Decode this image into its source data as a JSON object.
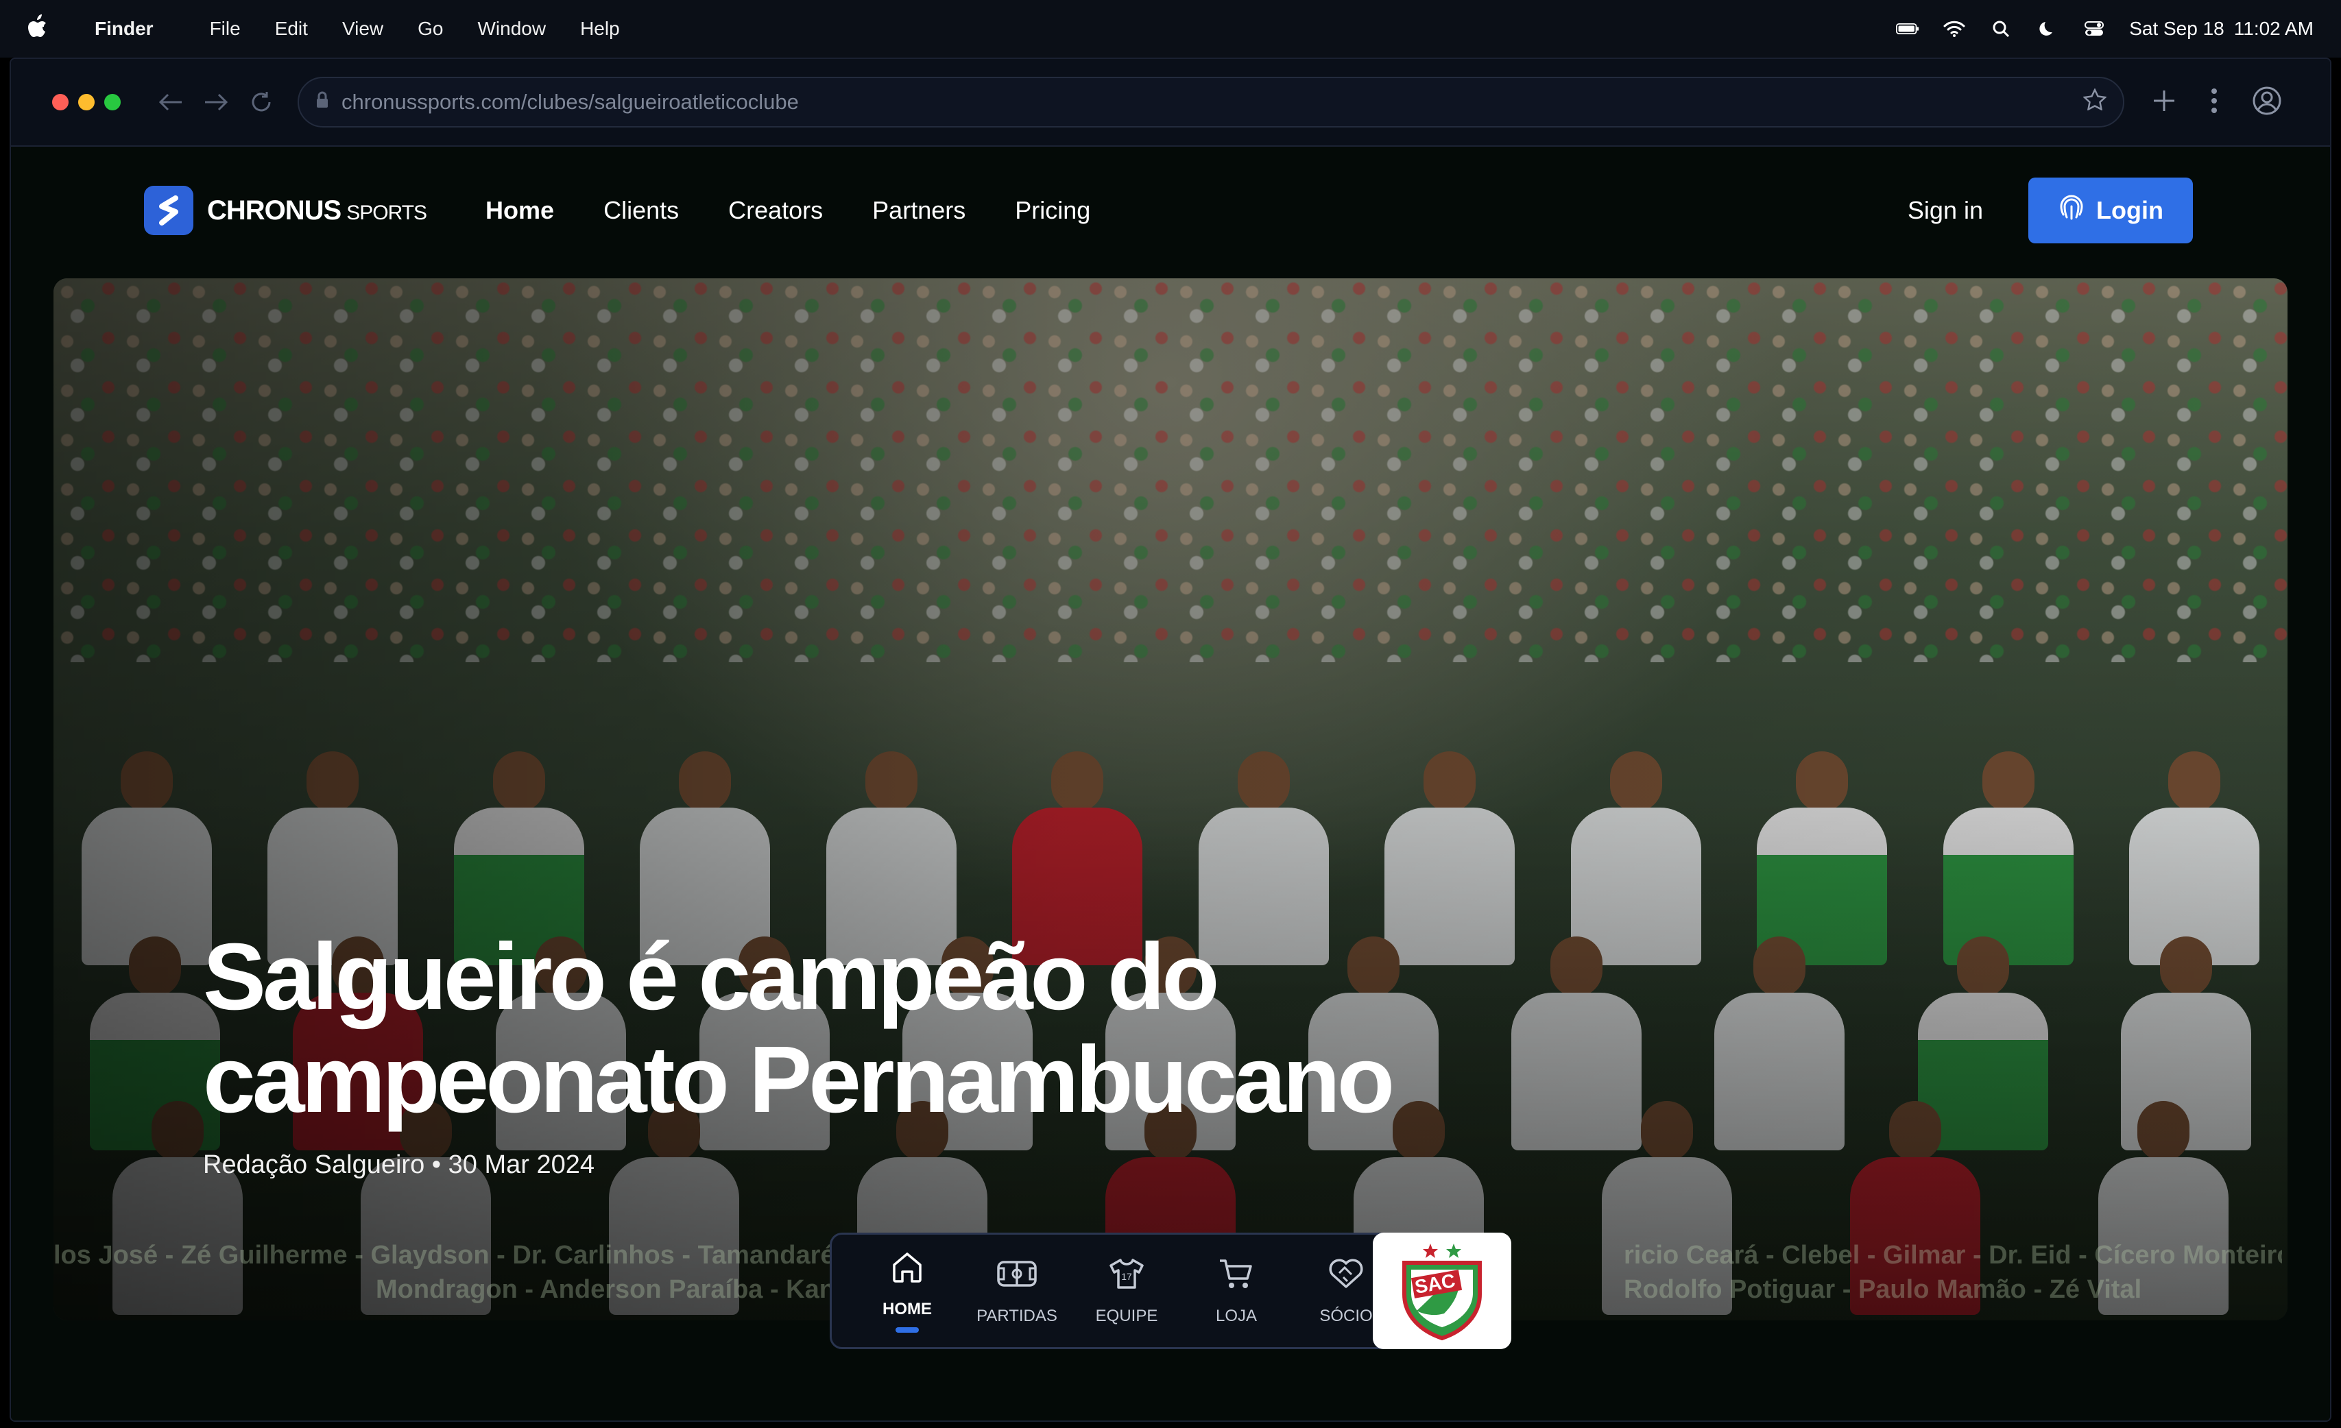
{
  "menubar": {
    "app": "Finder",
    "items": [
      "File",
      "Edit",
      "View",
      "Go",
      "Window",
      "Help"
    ],
    "date": "Sat Sep 18",
    "time": "11:02 AM"
  },
  "browser": {
    "url": "chronussports.com/clubes/salgueiroatleticoclube"
  },
  "site": {
    "brand_name": "CHRONUS",
    "brand_sub": "SPORTS",
    "nav": [
      "Home",
      "Clients",
      "Creators",
      "Partners",
      "Pricing"
    ],
    "sign_in": "Sign in",
    "login": "Login"
  },
  "hero": {
    "title_line1": "Salgueiro é campeão do",
    "title_line2": "campeonato Pernambucano",
    "author": "Redação Salgueiro",
    "date": "30 Mar 2024",
    "banner_left_line1": "los José - Zé Guilherme - Glaydson - Dr. Carlinhos - Tamandaré - Ric",
    "banner_left_line2": "Mondragon - Anderson Paraíba - Kanu -",
    "banner_right_line1": "ricio Ceará - Clebel - Gilmar - Dr. Eid - Cícero Monteiro - Alexandre",
    "banner_right_line2": "Rodolfo Potiguar - Paulo Mamão - Zé Vital"
  },
  "tabs": [
    {
      "label": "HOME",
      "icon": "home-icon",
      "active": true
    },
    {
      "label": "PARTIDAS",
      "icon": "soccer-field-icon",
      "active": false
    },
    {
      "label": "EQUIPE",
      "icon": "jersey-icon",
      "active": false
    },
    {
      "label": "LOJA",
      "icon": "cart-icon",
      "active": false
    },
    {
      "label": "SÓCIO",
      "icon": "heart-handshake-icon",
      "active": false
    }
  ],
  "crest_text": "SAC",
  "colors": {
    "accent": "#2f6fe6",
    "club_red": "#c8232e",
    "club_green": "#2f9a44"
  }
}
